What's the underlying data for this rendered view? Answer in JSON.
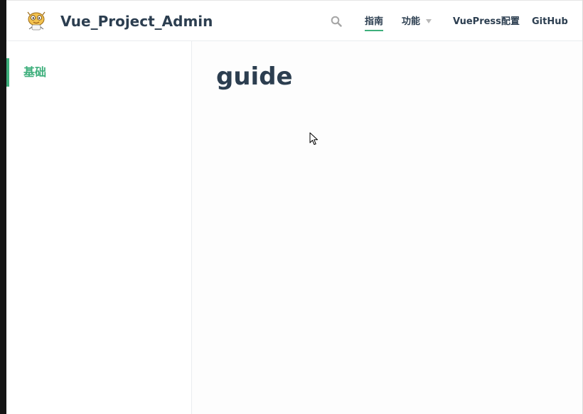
{
  "navbar": {
    "site_name": "Vue_Project_Admin",
    "logo_icon": "mascot-logo-icon",
    "search_icon": "search-icon",
    "links": [
      {
        "label": "指南",
        "active": true
      },
      {
        "label": "功能",
        "dropdown": true
      },
      {
        "label": "VuePress配置"
      },
      {
        "label": "GitHub"
      }
    ]
  },
  "sidebar": {
    "items": [
      {
        "label": "基础",
        "active": true
      }
    ]
  },
  "main": {
    "title": "guide"
  },
  "colors": {
    "accent": "#3eaf7c",
    "text": "#2c3e50",
    "border": "#eaecef"
  }
}
